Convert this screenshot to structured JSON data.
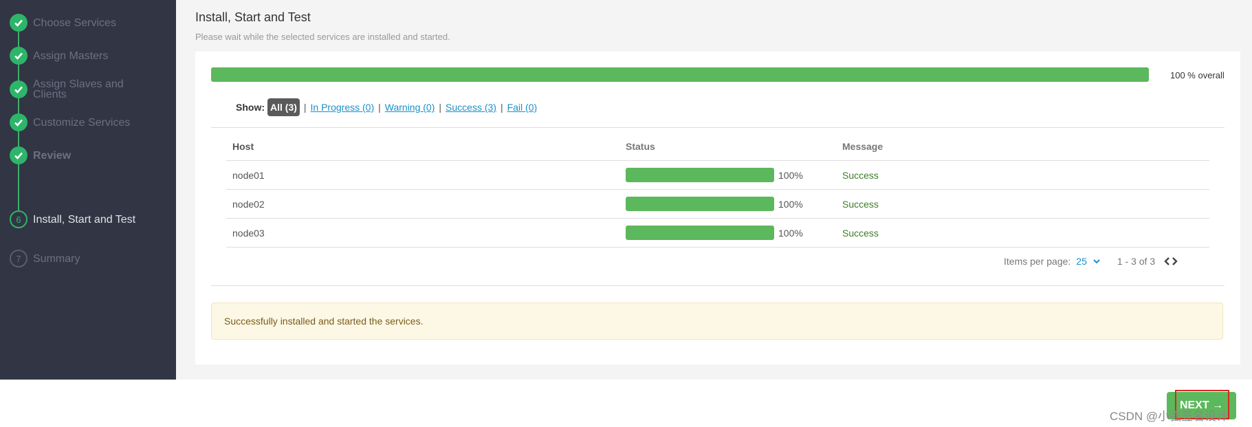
{
  "sidebar": {
    "steps": [
      {
        "number": "1",
        "label": "Choose Services",
        "state": "done",
        "icon": "check-icon"
      },
      {
        "number": "2",
        "label": "Assign Masters",
        "state": "done",
        "icon": "check-icon"
      },
      {
        "number": "3",
        "label": "Assign Slaves and Clients",
        "state": "done",
        "icon": "check-icon"
      },
      {
        "number": "4",
        "label": "Customize Services",
        "state": "done",
        "icon": "check-icon"
      },
      {
        "number": "5",
        "label": "Review",
        "state": "done",
        "icon": "check-icon"
      },
      {
        "number": "6",
        "label": "Install, Start and Test",
        "state": "current"
      },
      {
        "number": "7",
        "label": "Summary",
        "state": "future"
      }
    ]
  },
  "main": {
    "title": "Install, Start and Test",
    "subtitle": "Please wait while the selected services are installed and started.",
    "overall_progress": 1.0,
    "overall_text": "100 % overall",
    "filter": {
      "show_label": "Show:",
      "options": [
        "All (3)",
        "In Progress (0)",
        "Warning (0)",
        "Success (3)",
        "Fail (0)"
      ],
      "selected": "All (3)"
    },
    "table": {
      "headers": [
        "Host",
        "Status",
        "Message"
      ],
      "rows": [
        {
          "host": "node01",
          "progress": 1.0,
          "percent": "100%",
          "message": "Success"
        },
        {
          "host": "node02",
          "progress": 1.0,
          "percent": "100%",
          "message": "Success"
        },
        {
          "host": "node03",
          "progress": 1.0,
          "percent": "100%",
          "message": "Success"
        }
      ]
    },
    "pagination": {
      "items_per_page_label": "Items per page:",
      "items_per_page_value": "25",
      "range": "1 - 3 of 3"
    },
    "alert": "Successfully installed and started the services."
  },
  "footer": {
    "next_label": "NEXT →"
  },
  "watermark": "CSDN @小强签名设计",
  "colors": {
    "sidebar_bg": "#323544",
    "success_green": "#5cb85c",
    "step_green": "#2db56a",
    "link_blue": "#1a8fc9",
    "highlight_red": "#d9251e"
  }
}
